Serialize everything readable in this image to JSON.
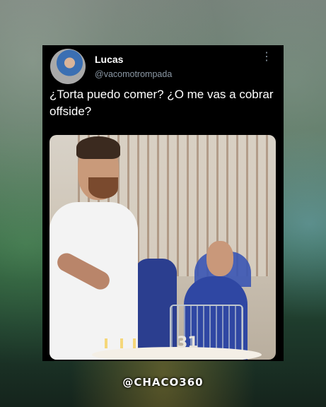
{
  "tweet": {
    "display_name": "Lucas",
    "handle": "@vacomotrompada",
    "text": "¿Torta puedo comer? ¿O me vas a cobrar offside?",
    "more_icon": "more-options-icon"
  },
  "photo": {
    "cake_number": "31"
  },
  "watermark": {
    "text": "@CHACO360"
  },
  "colors": {
    "card_background": "#000000",
    "handle_gray": "#8b98a5",
    "text_white": "#ffffff"
  }
}
